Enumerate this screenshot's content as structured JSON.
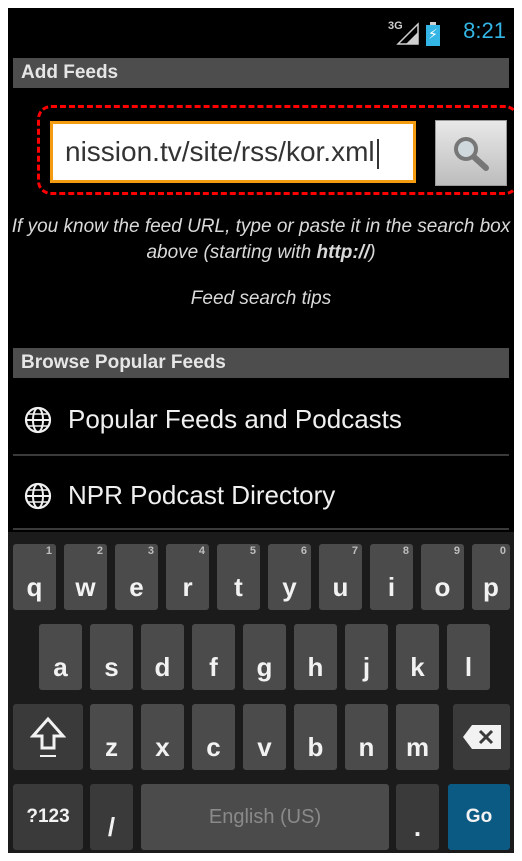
{
  "status_bar": {
    "network": "3G",
    "time": "8:21"
  },
  "add_feeds": {
    "header": "Add Feeds",
    "url_value": "nission.tv/site/rss/kor.xml",
    "help_text_pre": "If you know the feed URL, type or paste it in the search box above (starting with ",
    "help_text_bold": "http://",
    "help_text_post": ")",
    "tips_link": "Feed search tips"
  },
  "browse": {
    "header": "Browse Popular Feeds",
    "items": [
      {
        "label": "Popular Feeds and Podcasts",
        "icon": "globe-icon"
      },
      {
        "label": "NPR Podcast Directory",
        "icon": "globe-icon"
      }
    ]
  },
  "keyboard": {
    "row1": [
      {
        "ch": "q",
        "sub": "1"
      },
      {
        "ch": "w",
        "sub": "2"
      },
      {
        "ch": "e",
        "sub": "3"
      },
      {
        "ch": "r",
        "sub": "4"
      },
      {
        "ch": "t",
        "sub": "5"
      },
      {
        "ch": "y",
        "sub": "6"
      },
      {
        "ch": "u",
        "sub": "7"
      },
      {
        "ch": "i",
        "sub": "8"
      },
      {
        "ch": "o",
        "sub": "9"
      },
      {
        "ch": "p",
        "sub": "0"
      }
    ],
    "row2": [
      "a",
      "s",
      "d",
      "f",
      "g",
      "h",
      "j",
      "k",
      "l"
    ],
    "row3": [
      "z",
      "x",
      "c",
      "v",
      "b",
      "n",
      "m"
    ],
    "symbols_label": "?123",
    "slash_label": "/",
    "space_label": "English (US)",
    "period_label": ".",
    "go_label": "Go"
  },
  "colors": {
    "accent": "#33b5e5",
    "highlight_frame": "#ff0000",
    "input_border": "#f39c12",
    "go_key": "#0b5a84"
  }
}
